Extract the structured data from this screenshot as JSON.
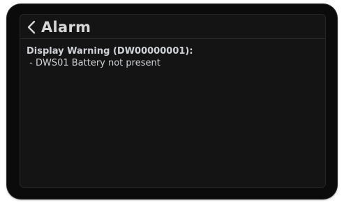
{
  "header": {
    "back_icon": "chevron-left-icon",
    "title": "Alarm"
  },
  "warning": {
    "title": "Display Warning (DW00000001):",
    "items": [
      {
        "text": " - DWS01 Battery not present"
      }
    ]
  },
  "colors": {
    "bezel": "#0b0b0b",
    "screen_background": "#141414",
    "text": "#cfd2d6",
    "title_text": "#d7d7d7"
  }
}
